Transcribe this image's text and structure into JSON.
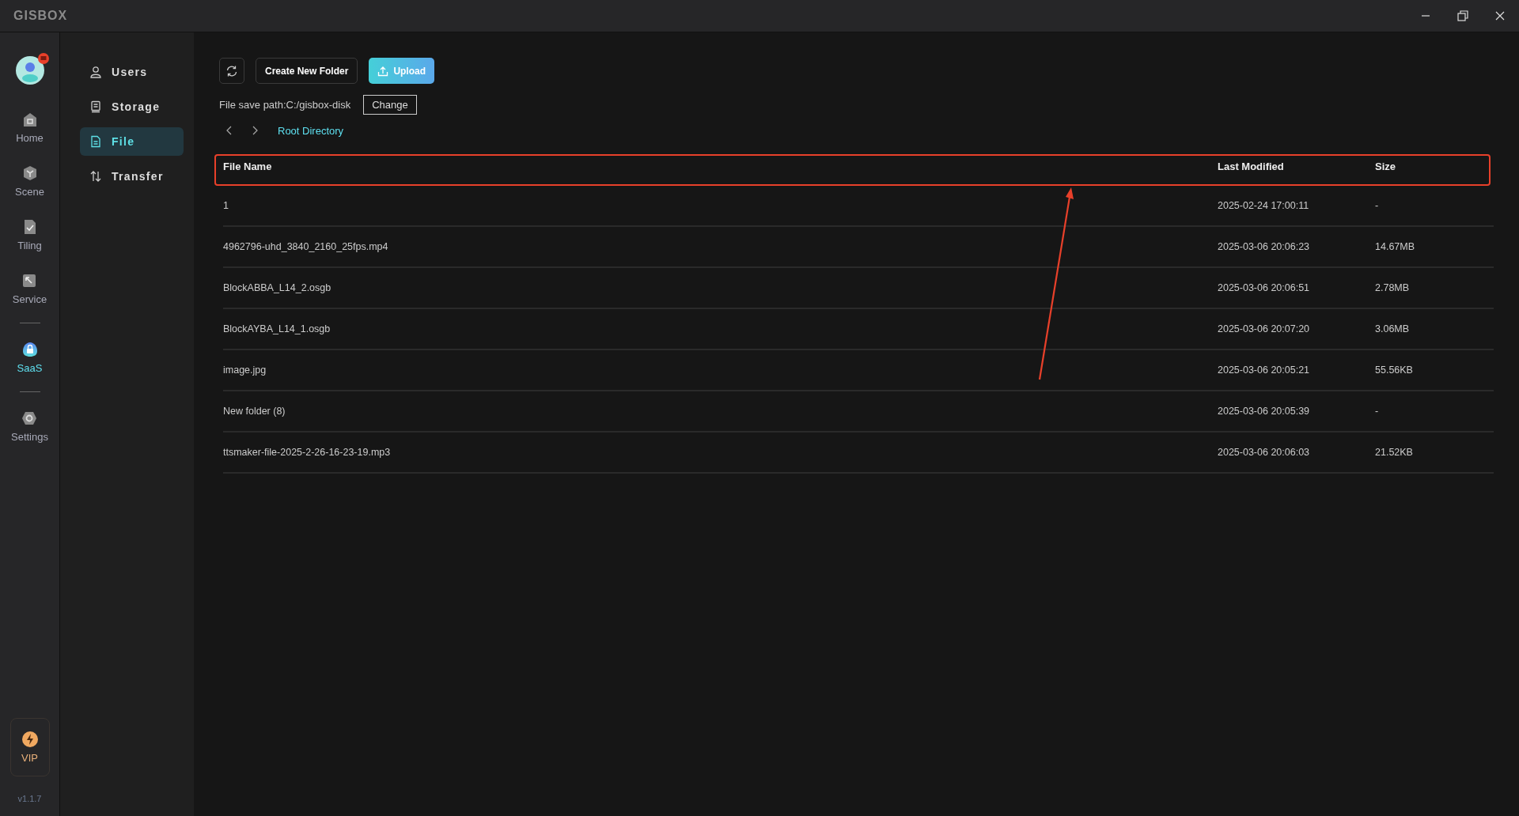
{
  "window": {
    "title": "GISBOX"
  },
  "rail": {
    "items": [
      {
        "kind": "nav",
        "label": "Home",
        "selected": false
      },
      {
        "kind": "nav",
        "label": "Scene",
        "selected": false
      },
      {
        "kind": "nav",
        "label": "Tiling",
        "selected": false
      },
      {
        "kind": "nav",
        "label": "Service",
        "selected": false
      },
      {
        "kind": "divider"
      },
      {
        "kind": "nav",
        "label": "SaaS",
        "selected": true
      },
      {
        "kind": "divider"
      },
      {
        "kind": "nav",
        "label": "Settings",
        "selected": false
      }
    ],
    "vip": {
      "label": "VIP"
    },
    "version": "v1.1.7"
  },
  "sidebar": {
    "items": [
      {
        "label": "Users",
        "selected": false
      },
      {
        "label": "Storage",
        "selected": false
      },
      {
        "label": "File",
        "selected": true
      },
      {
        "label": "Transfer",
        "selected": false
      }
    ]
  },
  "toolbar": {
    "create_label": "Create New Folder",
    "upload_label": "Upload"
  },
  "save_path": {
    "text": "File save path:C:/gisbox-disk",
    "button": "Change"
  },
  "breadcrumb": {
    "current": "Root Directory"
  },
  "table": {
    "columns": [
      "File Name",
      "Last Modified",
      "Size"
    ],
    "header_highlighted": true,
    "annotation_arrow": true,
    "rows": [
      [
        "1",
        "2025-02-24 17:00:11",
        "-"
      ],
      [
        "4962796-uhd_3840_2160_25fps.mp4",
        "2025-03-06 20:06:23",
        "14.67MB"
      ],
      [
        "BlockABBA_L14_2.osgb",
        "2025-03-06 20:06:51",
        "2.78MB"
      ],
      [
        "BlockAYBA_L14_1.osgb",
        "2025-03-06 20:07:20",
        "3.06MB"
      ],
      [
        "image.jpg",
        "2025-03-06 20:05:21",
        "55.56KB"
      ],
      [
        "New folder (8)",
        "2025-03-06 20:05:39",
        "-"
      ],
      [
        "ttsmaker-file-2025-2-26-16-23-19.mp3",
        "2025-03-06 20:06:03",
        "21.52KB"
      ]
    ]
  }
}
